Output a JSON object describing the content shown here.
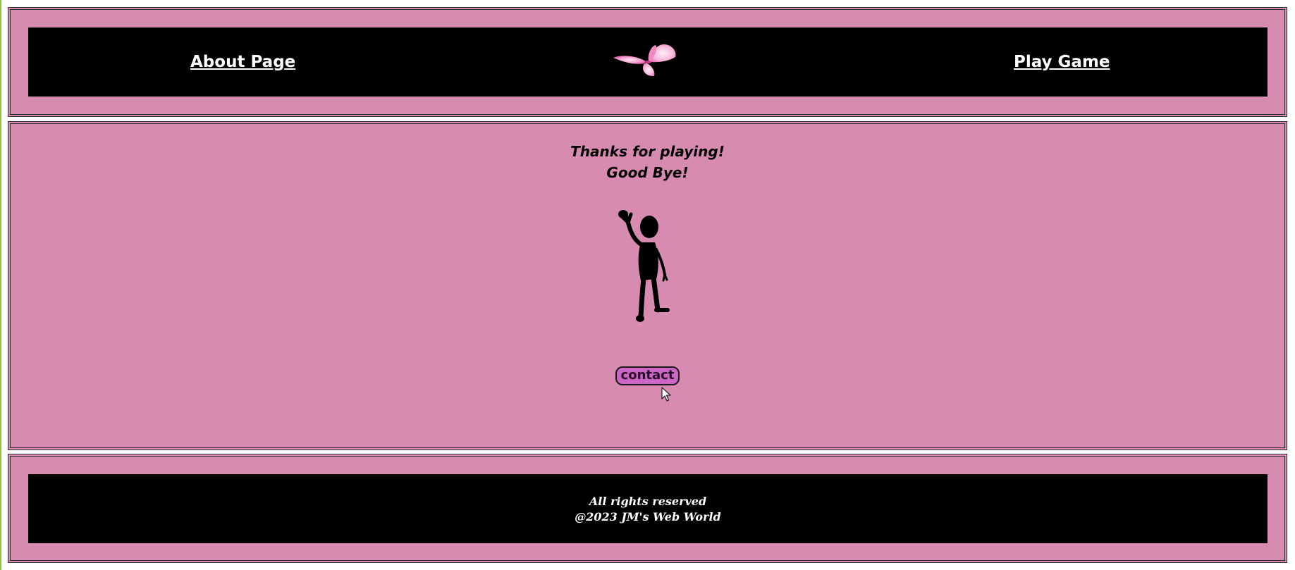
{
  "header": {
    "about_label": "About Page",
    "play_label": "Play Game",
    "logo_icon": "butterfly-icon"
  },
  "main": {
    "line1": "Thanks for playing!",
    "line2": "Good Bye!",
    "figure_icon": "waving-person-icon",
    "contact_label": "contact"
  },
  "footer": {
    "rights": "All rights reserved",
    "copyright": "@2023 JM's Web World"
  },
  "colors": {
    "background_pink": "#d88bb1",
    "bar_black": "#000000",
    "link_white": "#ffffff",
    "button_purple": "#cc66c4"
  }
}
